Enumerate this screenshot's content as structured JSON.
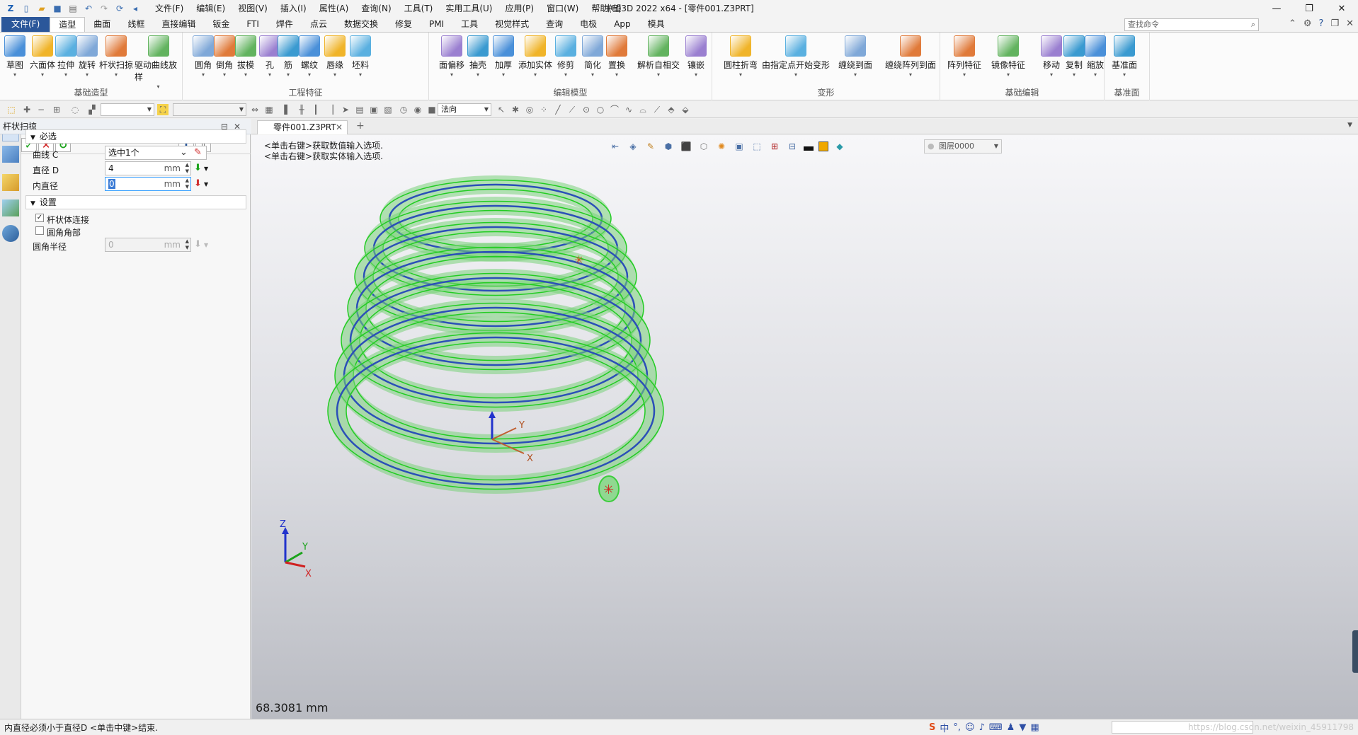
{
  "window": {
    "title": "中望3D 2022 x64 - [零件001.Z3PRT]",
    "controls": [
      "—",
      "❐",
      "✕"
    ]
  },
  "menu": [
    "文件(F)",
    "编辑(E)",
    "视图(V)",
    "插入(I)",
    "属性(A)",
    "查询(N)",
    "工具(T)",
    "实用工具(U)",
    "应用(P)",
    "窗口(W)",
    "帮助(H)"
  ],
  "tabs": {
    "file": "文件(F)",
    "items": [
      "造型",
      "曲面",
      "线框",
      "直接编辑",
      "钣金",
      "FTI",
      "焊件",
      "点云",
      "数据交换",
      "修复",
      "PMI",
      "工具",
      "视觉样式",
      "查询",
      "电极",
      "App",
      "模具"
    ],
    "active": "造型"
  },
  "search": {
    "placeholder": "查找命令"
  },
  "ribbon": {
    "groups": [
      {
        "title": "基础造型",
        "buttons": [
          "草图",
          "六面体",
          "拉伸",
          "旋转",
          "杆状扫掠",
          "驱动曲线放样"
        ]
      },
      {
        "title": "工程特征",
        "buttons": [
          "圆角",
          "倒角",
          "拔模",
          "孔",
          "筋",
          "螺纹",
          "唇缘",
          "坯料"
        ]
      },
      {
        "title": "编辑模型",
        "buttons": [
          "面偏移",
          "抽壳",
          "加厚",
          "添加实体",
          "修剪",
          "简化",
          "置换",
          "解析自相交",
          "镶嵌"
        ]
      },
      {
        "title": "变形",
        "buttons": [
          "圆柱折弯",
          "由指定点开始变形",
          "缠绕到面",
          "缠绕阵列到面"
        ]
      },
      {
        "title": "基础编辑",
        "buttons": [
          "阵列特征",
          "镜像特征",
          "移动",
          "复制",
          "缩放"
        ]
      },
      {
        "title": "基准面",
        "buttons": [
          "基准面"
        ]
      }
    ]
  },
  "toolbar2": {
    "combo3": "法向"
  },
  "panel": {
    "title": "杆状扫掠",
    "required_label": "必选",
    "settings_label": "设置",
    "fields": {
      "curve": {
        "label": "曲线 C",
        "value": "选中1个"
      },
      "diameter": {
        "label": "直径 D",
        "value": "4",
        "unit": "mm"
      },
      "inner": {
        "label": "内直径",
        "value": "0",
        "unit": "mm"
      },
      "fillet_radius": {
        "label": "圆角半径",
        "value": "0",
        "unit": "mm"
      }
    },
    "checks": {
      "rod_connect": {
        "label": "杆状体连接",
        "checked": true
      },
      "round_corner": {
        "label": "圆角角部",
        "checked": false
      }
    }
  },
  "document": {
    "tab": "零件001.Z3PRT"
  },
  "viewport": {
    "prompt_line1": "<单击右键>获取数值输入选项.",
    "prompt_line2": "<单击右键>获取实体输入选项.",
    "layer": "图层0000",
    "measure": "68.3081 mm",
    "axes": {
      "x": "X",
      "y": "Y",
      "z": "Z"
    },
    "colors": {
      "tube": "#7ad27a",
      "edge": "#22cc22",
      "path": "#2b4fb8"
    }
  },
  "status": {
    "message": "内直径必须小于直径D <单击中键>结束.",
    "watermark": "https://blog.csdn.net/weixin_45911798"
  }
}
